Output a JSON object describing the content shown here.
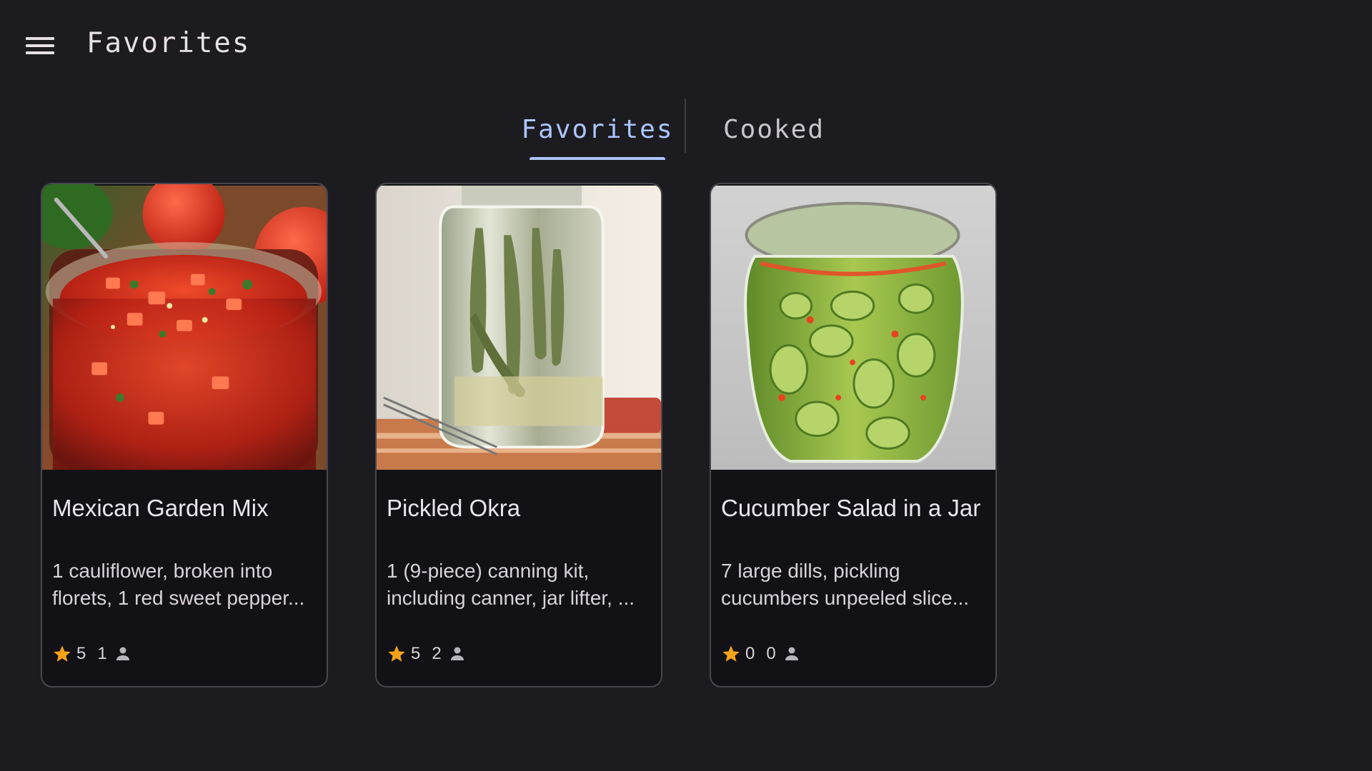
{
  "app_bar": {
    "menu_icon": "menu-icon",
    "title": "Favorites"
  },
  "tabs": [
    {
      "label": "Favorites",
      "selected": true
    },
    {
      "label": "Cooked",
      "selected": false
    }
  ],
  "colors": {
    "background": "#1c1b20",
    "tab_active": "#adc6ff",
    "star": "#f5a21b",
    "card_bg": "#121216"
  },
  "recipes": [
    {
      "title": "Mexican Garden Mix",
      "description": "1 cauliflower, broken into florets, 1 red sweet pepper...",
      "rating": "5",
      "cooked_count": "1",
      "image": "salsa-in-jar"
    },
    {
      "title": "Pickled Okra",
      "description": "1 (9-piece) canning kit, including canner, jar lifter, ...",
      "rating": "5",
      "cooked_count": "2",
      "image": "okra-in-mason-jar"
    },
    {
      "title": "Cucumber Salad in a Jar",
      "description": "7 large dills, pickling cucumbers unpeeled slice...",
      "rating": "0",
      "cooked_count": "0",
      "image": "cucumbers-in-jar"
    }
  ]
}
